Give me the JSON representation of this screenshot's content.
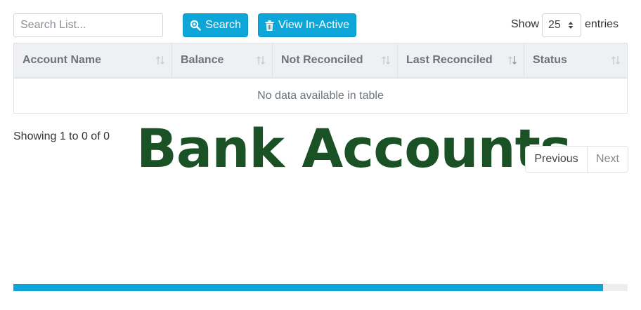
{
  "toolbar": {
    "search_placeholder": "Search List...",
    "search_button_label": "Search",
    "inactive_button_label": "View In-Active",
    "show_label": "Show",
    "page_size": "25",
    "entries_label": "entries"
  },
  "table": {
    "columns": [
      "Account Name",
      "Balance",
      "Not Reconciled",
      "Last Reconciled",
      "Status"
    ],
    "empty_message": "No data available in table"
  },
  "footer": {
    "info": "Showing 1 to 0 of 0",
    "previous_label": "Previous",
    "next_label": "Next"
  },
  "overlay_title": "Bank Accounts",
  "progress": {
    "fraction": 0.96
  },
  "colors": {
    "accent": "#0ea5d8",
    "title": "#1a5226",
    "header_bg": "#eef0f3"
  }
}
